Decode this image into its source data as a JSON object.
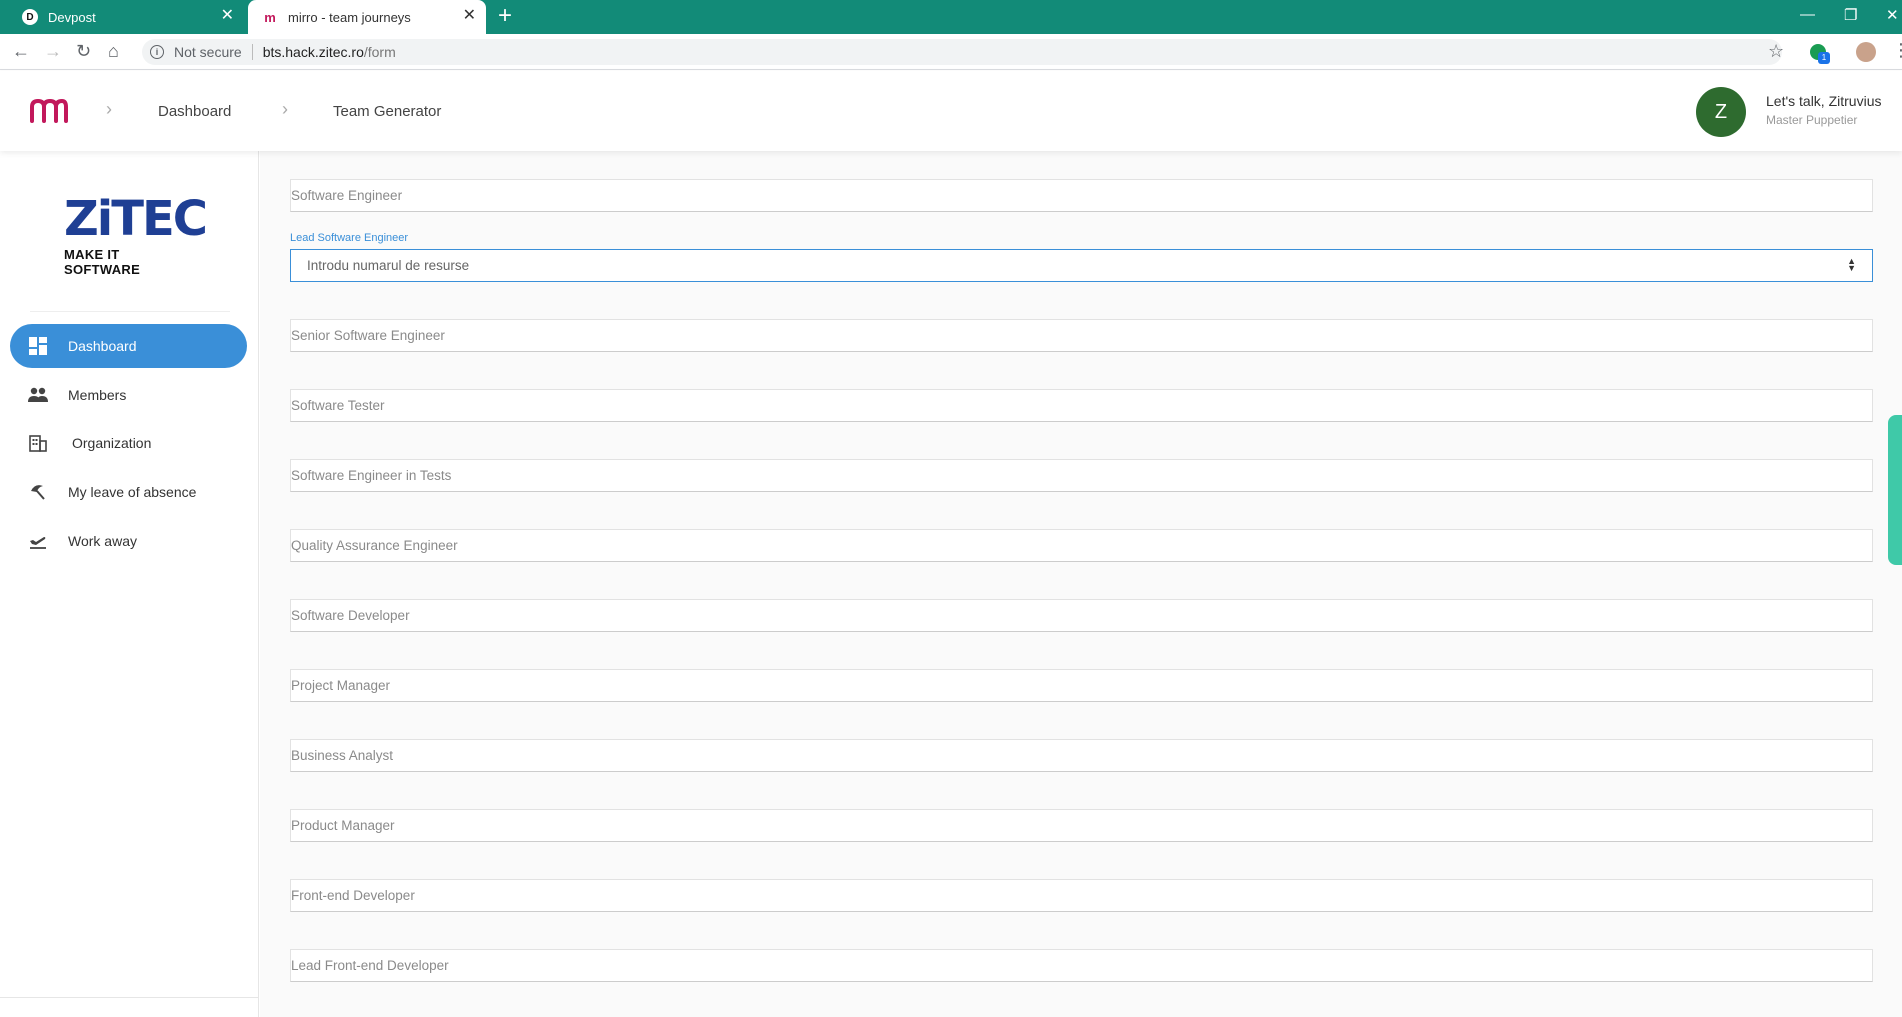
{
  "browser": {
    "tabs": [
      {
        "title": "Devpost",
        "favicon": "D"
      },
      {
        "title": "mirro - team journeys",
        "favicon": "m"
      }
    ],
    "security_label": "Not secure",
    "url_host": "bts.hack.zitec.ro",
    "url_path": "/form",
    "extension_badge": "1"
  },
  "header": {
    "breadcrumbs": [
      "Dashboard",
      "Team Generator"
    ],
    "avatar_letter": "Z",
    "greeting": "Let's talk, Zitruvius",
    "role": "Master Puppetier"
  },
  "sidebar": {
    "logo_word": "ZiTEC",
    "logo_tagline": "MAKE IT SOFTWARE",
    "items": [
      {
        "label": "Dashboard",
        "icon": "dashboard-icon",
        "active": true
      },
      {
        "label": "Members",
        "icon": "people-icon",
        "active": false
      },
      {
        "label": "Organization",
        "icon": "building-icon",
        "active": false
      },
      {
        "label": "My leave of absence",
        "icon": "beach-umbrella-icon",
        "active": false
      },
      {
        "label": "Work away",
        "icon": "flight-takeoff-icon",
        "active": false
      }
    ]
  },
  "form": {
    "active_label": "Lead Software Engineer",
    "active_placeholder": "Introdu numarul de resurse",
    "fields": [
      "Software Engineer",
      "Senior Software Engineer",
      "Software Tester",
      "Software Engineer in Tests",
      "Quality Assurance Engineer",
      "Software Developer",
      "Project Manager",
      "Business Analyst",
      "Product Manager",
      "Front-end Developer",
      "Lead Front-end Developer"
    ]
  },
  "colors": {
    "browser_frame": "#128b78",
    "accent": "#3a8fd8",
    "brand_pink": "#c2185b",
    "avatar": "#2e6b2f",
    "zitec_blue": "#1f3f94",
    "feedback": "#3fc9a8"
  }
}
